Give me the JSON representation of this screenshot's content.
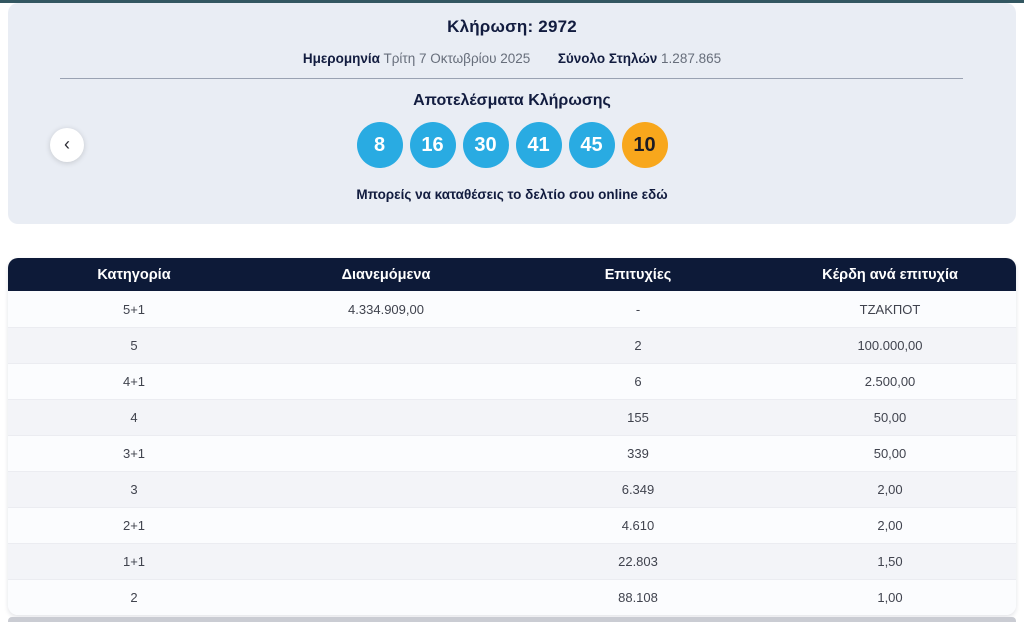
{
  "header": {
    "draw_title": "Κλήρωση: 2972",
    "date_label": "Ημερομηνία",
    "date_value": "Τρίτη 7 Οκτωβρίου 2025",
    "total_columns_label": "Σύνολο Στηλών",
    "total_columns_value": "1.287.865"
  },
  "results": {
    "title": "Αποτελέσματα Κλήρωσης",
    "numbers": [
      "8",
      "16",
      "30",
      "41",
      "45"
    ],
    "joker_number": "10",
    "online_link_text": "Μπορείς να καταθέσεις το δελτίο σου online εδώ",
    "prev_button_glyph": "‹"
  },
  "colors": {
    "accent_teal": "#335761",
    "panel_bg": "#e9edf4",
    "ball_blue": "#29abe2",
    "ball_orange": "#f8a71c",
    "table_header_navy": "#0d1a38",
    "text_navy": "#121c3f"
  },
  "table": {
    "headers": [
      "Κατηγορία",
      "Διανεμόμενα",
      "Επιτυχίες",
      "Κέρδη ανά επιτυχία"
    ],
    "rows": [
      {
        "category": "5+1",
        "distributed": "4.334.909,00",
        "winners": "-",
        "prize": "ΤΖΑΚΠΟΤ"
      },
      {
        "category": "5",
        "distributed": "",
        "winners": "2",
        "prize": "100.000,00"
      },
      {
        "category": "4+1",
        "distributed": "",
        "winners": "6",
        "prize": "2.500,00"
      },
      {
        "category": "4",
        "distributed": "",
        "winners": "155",
        "prize": "50,00"
      },
      {
        "category": "3+1",
        "distributed": "",
        "winners": "339",
        "prize": "50,00"
      },
      {
        "category": "3",
        "distributed": "",
        "winners": "6.349",
        "prize": "2,00"
      },
      {
        "category": "2+1",
        "distributed": "",
        "winners": "4.610",
        "prize": "2,00"
      },
      {
        "category": "1+1",
        "distributed": "",
        "winners": "22.803",
        "prize": "1,50"
      },
      {
        "category": "2",
        "distributed": "",
        "winners": "88.108",
        "prize": "1,00"
      }
    ]
  }
}
